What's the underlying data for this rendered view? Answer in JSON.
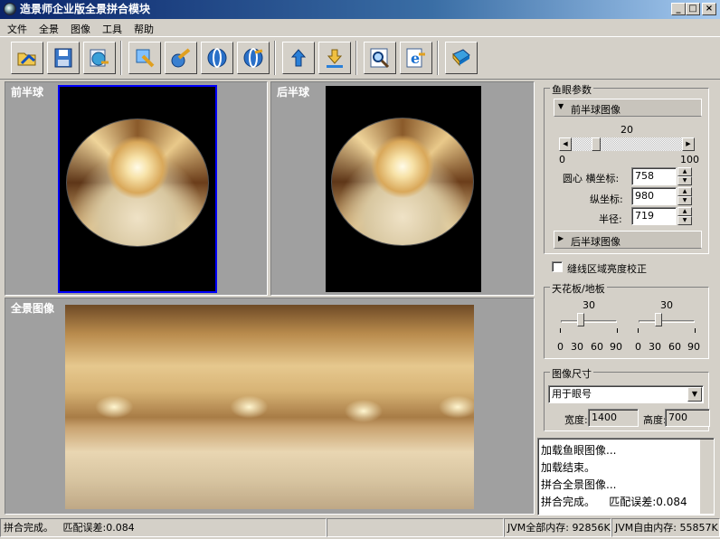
{
  "window": {
    "title": "造景师企业版全景拼合模块",
    "minimize": "_",
    "maximize": "□",
    "close": "×"
  },
  "menu": {
    "items": [
      "文件",
      "全景",
      "图像",
      "工具",
      "帮助"
    ]
  },
  "toolbar": {
    "icons": [
      "open-folder-icon",
      "save-disk-icon",
      "export-globe-icon",
      "select-arrow-icon",
      "rotate-icon",
      "front-sphere-icon",
      "back-sphere-icon",
      "upload-icon",
      "download-icon",
      "zoom-icon",
      "internet-explorer-icon",
      "help-book-icon"
    ]
  },
  "panels": {
    "front": "前半球",
    "back": "后半球",
    "panorama": "全景图像"
  },
  "fisheye_params": {
    "group": "鱼眼参数",
    "front_section": "前半球图像",
    "back_section": "后半球图像",
    "slider": {
      "value": "20",
      "min": "0",
      "max": "100",
      "level": 0.2
    },
    "center_x_label": "圆心 横坐标:",
    "center_x": "758",
    "center_y_label": "纵坐标:",
    "center_y": "980",
    "radius_label": "半径:",
    "radius": "719"
  },
  "seam_checkbox": {
    "label": "缝线区域亮度校正",
    "checked": false
  },
  "ceiling": {
    "group": "天花板/地板",
    "left": {
      "value": "30",
      "ticks": [
        "0",
        "30",
        "60",
        "90"
      ],
      "level": 0.333
    },
    "right": {
      "value": "30",
      "ticks": [
        "0",
        "30",
        "60",
        "90"
      ],
      "level": 0.333
    }
  },
  "image_size": {
    "group": "图像尺寸",
    "select": "用于眼号",
    "width_label": "宽度:",
    "width": "1400",
    "height_label": "高度:",
    "height": "700"
  },
  "log": [
    "加载鱼眼图像...",
    "加载结束。",
    "拼合全景图像...",
    "拼合完成。    匹配误差:0.084"
  ],
  "status": {
    "main": "拼合完成。   匹配误差:0.084",
    "empty": "",
    "total_mem": "JVM全部内存: 92856K",
    "free_mem": "JVM自由内存: 55857K"
  }
}
